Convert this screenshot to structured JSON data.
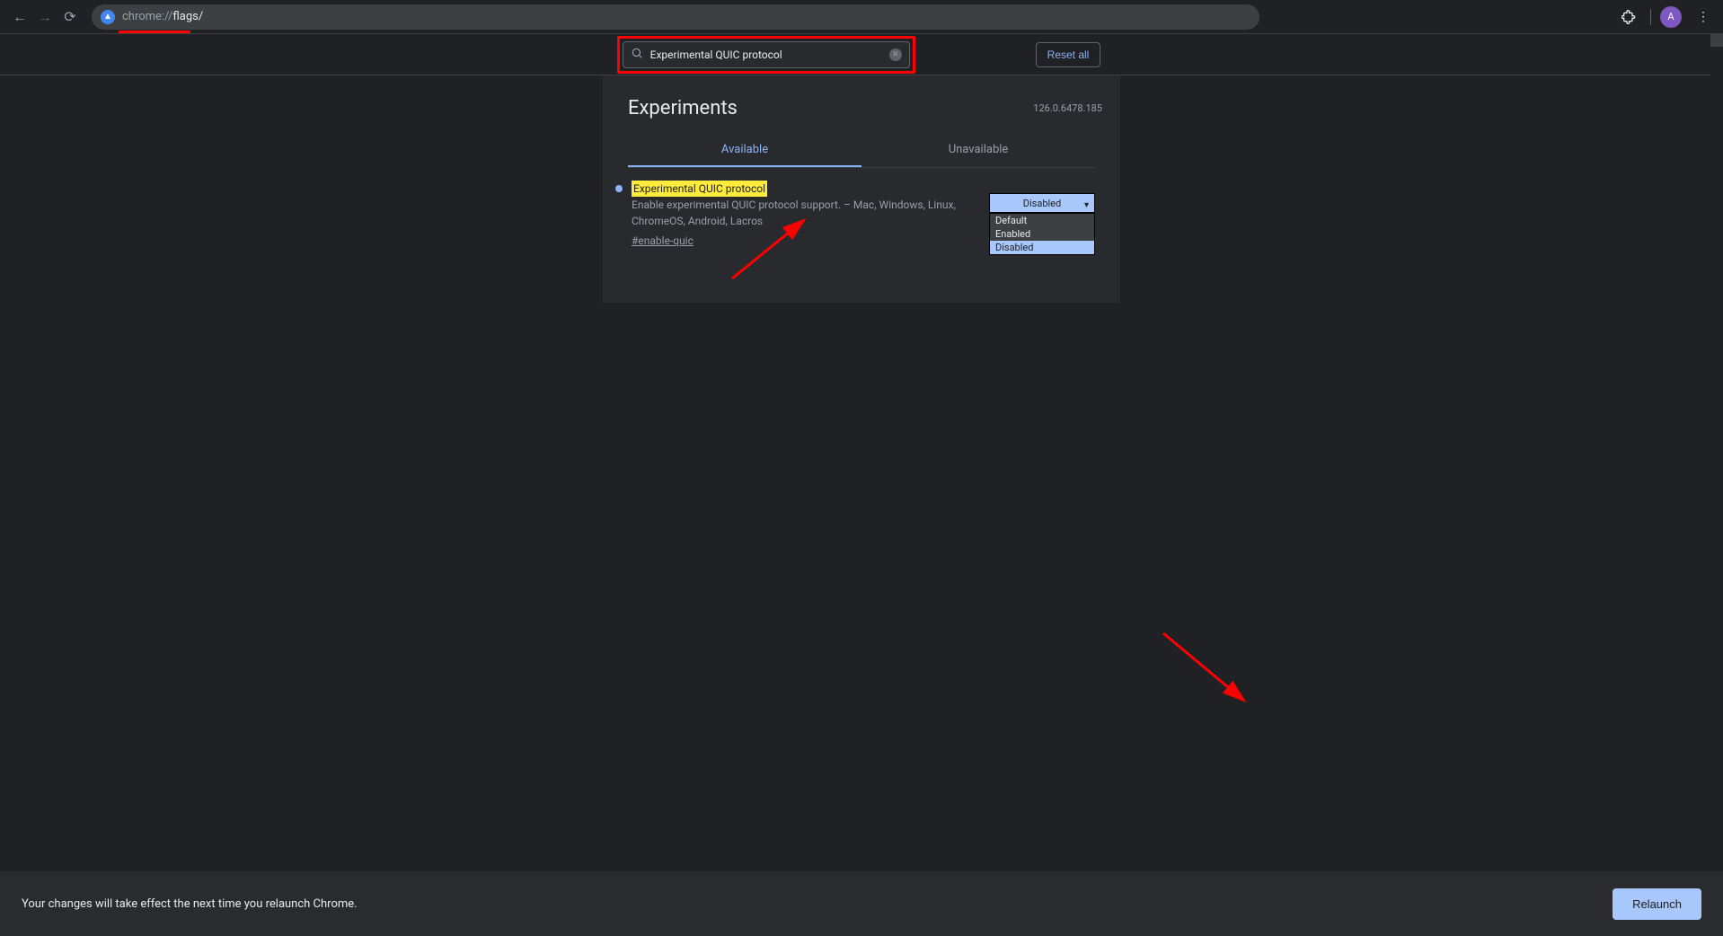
{
  "browser": {
    "url_prefix": "chrome://",
    "url_path": "flags/",
    "avatar_initial": "A"
  },
  "toolbar": {
    "search_value": "Experimental QUIC protocol",
    "reset_label": "Reset all"
  },
  "page": {
    "title": "Experiments",
    "version": "126.0.6478.185"
  },
  "tabs": {
    "available": "Available",
    "unavailable": "Unavailable"
  },
  "flag": {
    "title": "Experimental QUIC protocol",
    "description": "Enable experimental QUIC protocol support. – Mac, Windows, Linux, ChromeOS, Android, Lacros",
    "hash": "#enable-quic",
    "selected": "Disabled",
    "options": [
      "Default",
      "Enabled",
      "Disabled"
    ]
  },
  "footer": {
    "message": "Your changes will take effect the next time you relaunch Chrome.",
    "relaunch": "Relaunch"
  }
}
